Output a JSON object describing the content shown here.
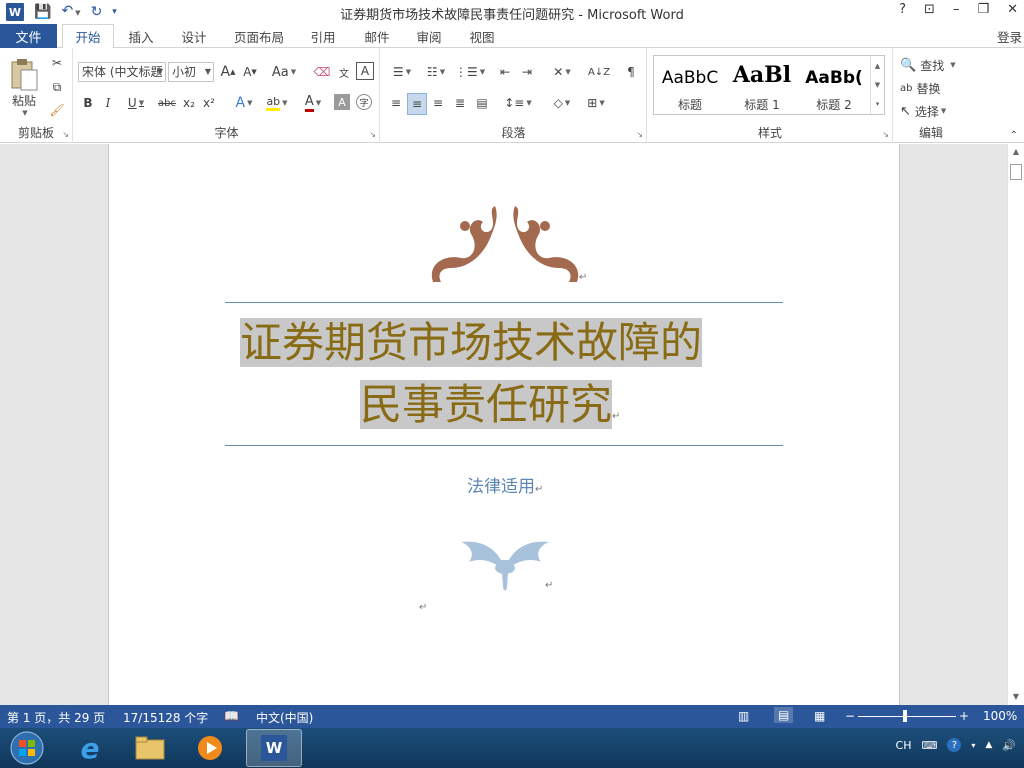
{
  "window": {
    "title": "证券期货市场技术故障民事责任问题研究 - Microsoft Word",
    "controls": [
      "?",
      "⊡",
      "–",
      "❐",
      "✕"
    ]
  },
  "qat": {
    "save": "💾",
    "undo": "↶",
    "redo": "↻"
  },
  "tabs": {
    "file": "文件",
    "items": [
      "开始",
      "插入",
      "设计",
      "页面布局",
      "引用",
      "邮件",
      "审阅",
      "视图"
    ],
    "active": "开始",
    "login": "登录"
  },
  "ribbon": {
    "clipboard": {
      "paste": "粘贴",
      "label": "剪贴板"
    },
    "font": {
      "face": "宋体 (中文标题",
      "size": "小初",
      "grow": "A",
      "shrink": "A",
      "case": "Aa",
      "bold": "B",
      "italic": "I",
      "underline": "U",
      "strike": "abc",
      "sub": "x₂",
      "sup": "x²",
      "label": "字体"
    },
    "paragraph": {
      "label": "段落"
    },
    "styles": {
      "items": [
        {
          "sample": "AaBbC",
          "name": "标题"
        },
        {
          "sample": "AaBl",
          "name": "标题 1"
        },
        {
          "sample": "AaBb(",
          "name": "标题 2"
        }
      ],
      "label": "样式"
    },
    "editing": {
      "find": "查找",
      "replace": "替换",
      "select": "选择",
      "label": "编辑"
    }
  },
  "document": {
    "title_line1": "证券期货市场技术故障的",
    "title_line2": "民事责任研究",
    "subtitle": "法律适用",
    "para_mark": "↵"
  },
  "status": {
    "page": "第 1 页，共 29 页",
    "words": "17/15128 个字",
    "language": "中文(中国)",
    "zoom": "100%"
  },
  "tray": {
    "lang": "CH"
  },
  "colors": {
    "accent": "#2b579a",
    "title": "#8a6b15",
    "subtitle": "#5b87b5",
    "ornament_top": "#a36a4f",
    "ornament_bottom": "#a9c2dc"
  }
}
